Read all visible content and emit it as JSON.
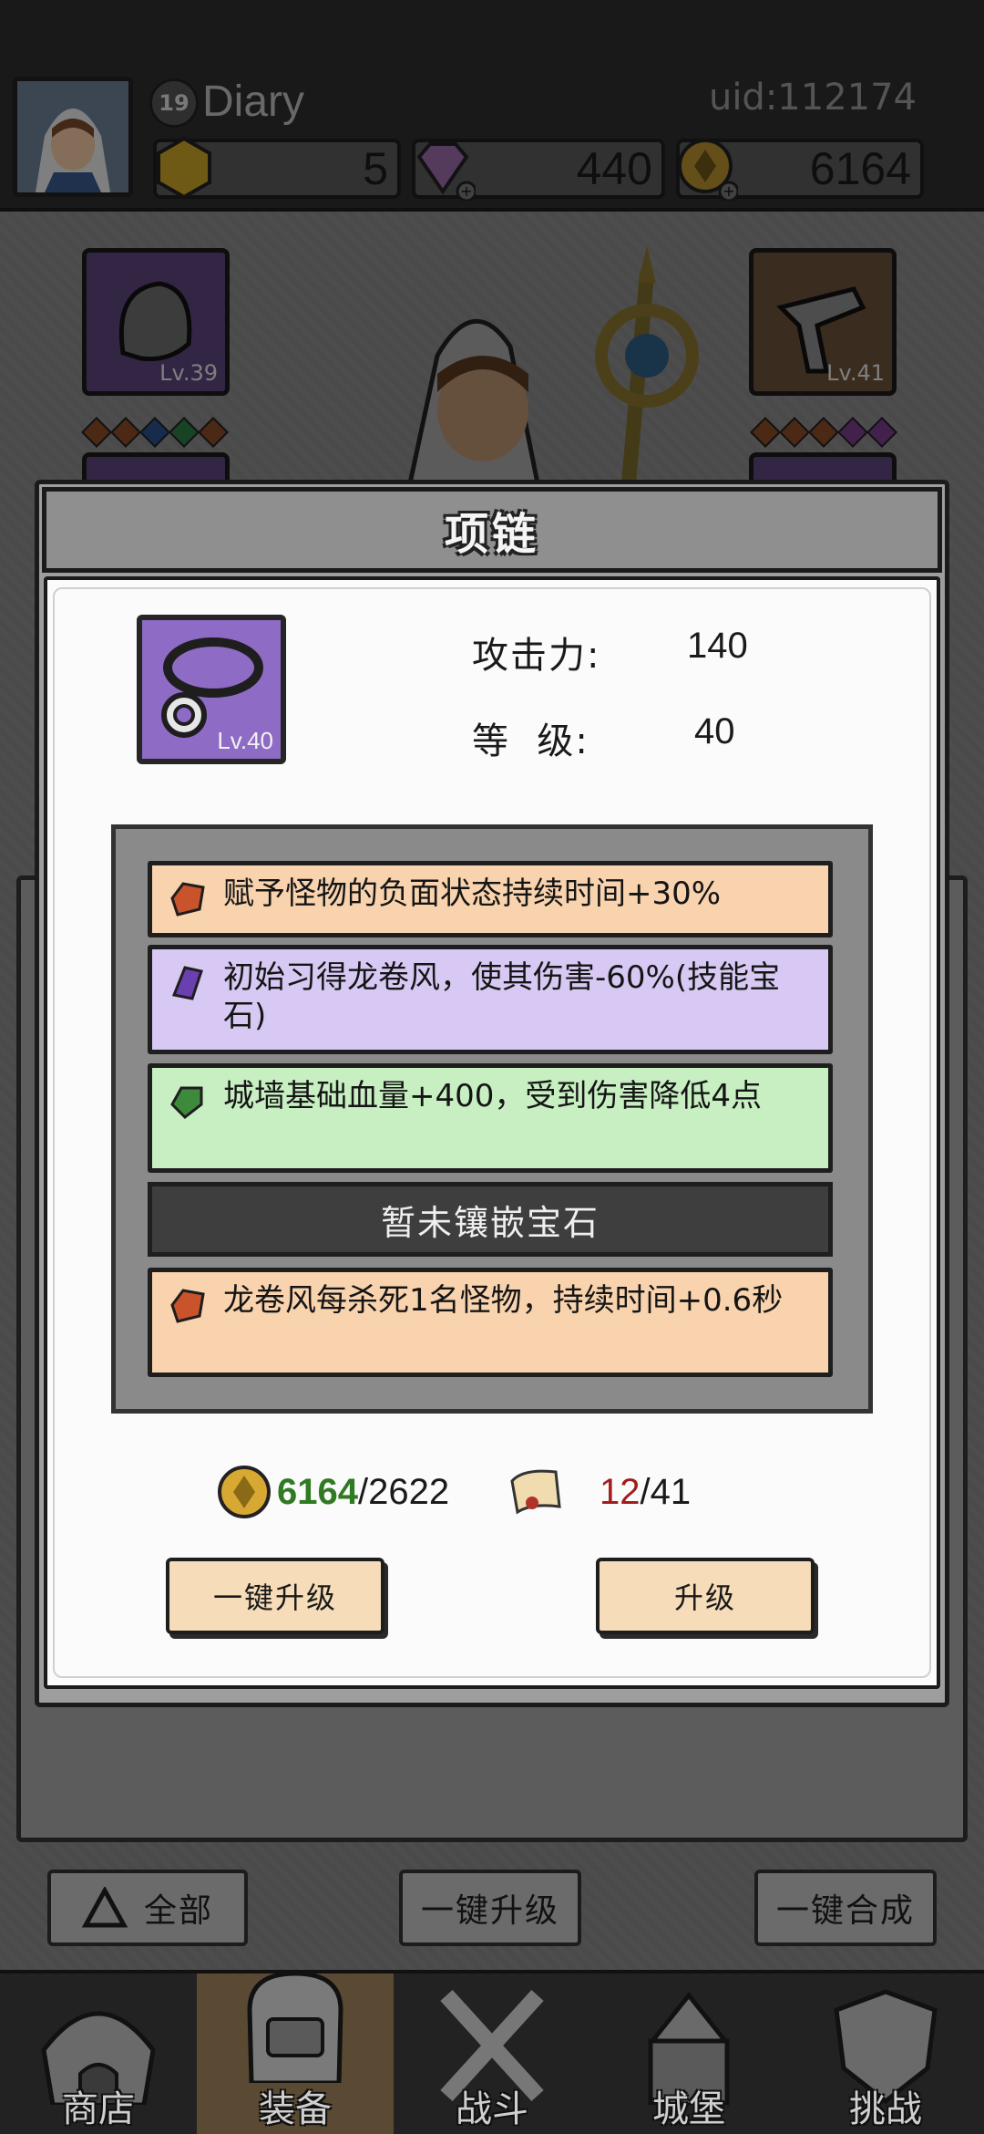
{
  "player": {
    "level": "19",
    "name": "Diary",
    "uid": "uid:112174"
  },
  "resources": {
    "stamina": "5",
    "diamonds": "440",
    "gold": "6164"
  },
  "slots": {
    "left_lv": "Lv.39",
    "right_lv": "Lv.41"
  },
  "modal": {
    "title": "项链",
    "item_lv": "Lv.40",
    "attack_label": "攻击力:",
    "attack_value": "140",
    "level_label": "等  级:",
    "level_value": "40",
    "gems": [
      {
        "text": "赋予怪物的负面状态持续时间+30%",
        "color": "orange"
      },
      {
        "text": "初始习得龙卷风，使其伤害-60%(技能宝石)",
        "color": "purple"
      },
      {
        "text": "城墙基础血量+400，受到伤害降低4点",
        "color": "green"
      }
    ],
    "empty_gem": "暂未镶嵌宝石",
    "gem_last": {
      "text": "龙卷风每杀死1名怪物，持续时间+0.6秒",
      "color": "orange"
    },
    "cost_gold_have": "6164",
    "cost_gold_need": "/2622",
    "cost_scroll_have": "12",
    "cost_scroll_need": "/41",
    "btn_auto_upgrade": "一键升级",
    "btn_upgrade": "升级"
  },
  "actions": {
    "filter_all": "全部",
    "auto_upgrade": "一键升级",
    "auto_merge": "一键合成"
  },
  "nav": {
    "shop": "商店",
    "equipment": "装备",
    "battle": "战斗",
    "castle": "城堡",
    "challenge": "挑战"
  },
  "colors": {
    "gem_orange_bg": "#f8d3ae",
    "gem_purple_bg": "#d7c9f3",
    "gem_green_bg": "#c7efc2",
    "button_bg": "#f6dcb8",
    "gold_have": "#2f7a22",
    "scroll_have": "#a31c1c"
  }
}
